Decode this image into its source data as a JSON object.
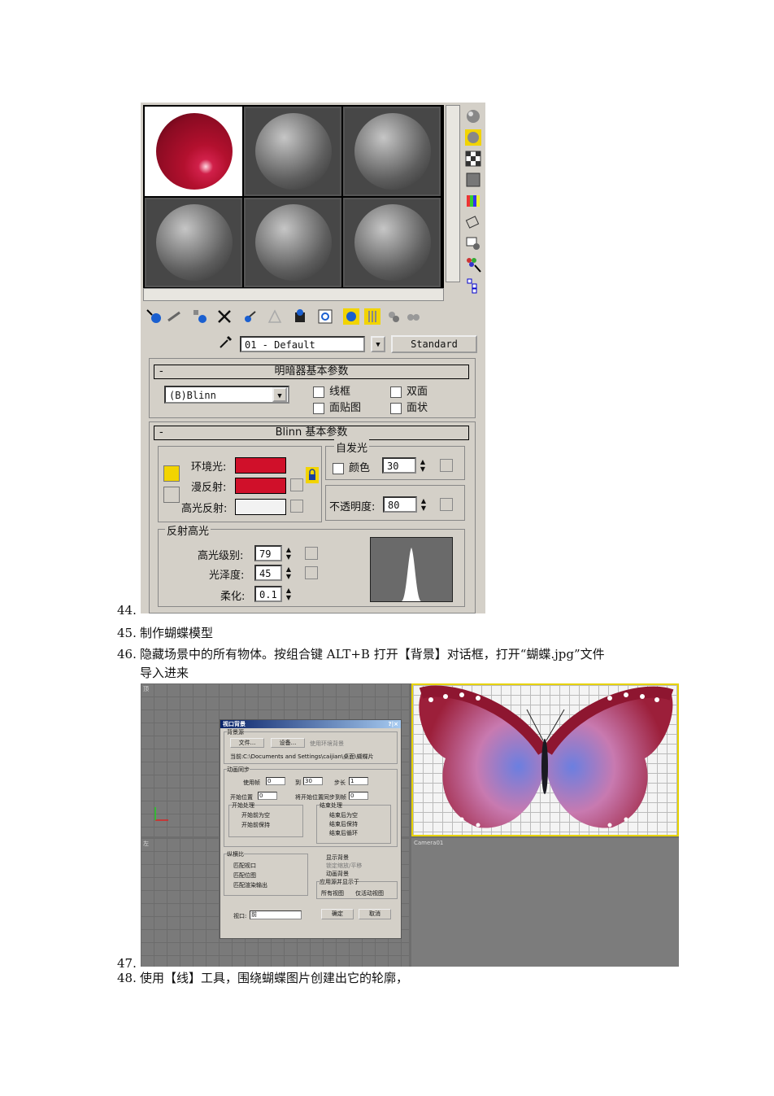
{
  "document": {
    "lines": [
      {
        "num": "44.",
        "text": ""
      },
      {
        "num": "45.",
        "text": "制作蝴蝶模型"
      },
      {
        "num": "46.",
        "text": "隐藏场景中的所有物体。按组合键 ALT+B 打开【背景】对话框，打开“蝴蝶.jpg”文件"
      },
      {
        "num": "",
        "text": "导入进来"
      },
      {
        "num": "47.",
        "text": ""
      },
      {
        "num": "48.",
        "text": "使用【线】工具，围绕蝴蝶图片创建出它的轮廓，"
      }
    ]
  },
  "material_editor": {
    "material_name": "01 - Default",
    "material_type": "Standard",
    "shader_rollout": {
      "title": "明暗器基本参数",
      "shader": "(B)Blinn",
      "checkboxes": [
        "线框",
        "双面",
        "面贴图",
        "面状"
      ]
    },
    "blinn_rollout": {
      "title": "Blinn 基本参数",
      "ambient_label": "环境光:",
      "diffuse_label": "漫反射:",
      "specular_label": "高光反射:",
      "self_illum_title": "自发光",
      "self_illum_color_label": "颜色",
      "self_illum_value": "30",
      "opacity_label": "不透明度:",
      "opacity_value": "80",
      "highlight_title": "反射高光",
      "spec_level_label": "高光级别:",
      "spec_level_value": "79",
      "gloss_label": "光泽度:",
      "gloss_value": "45",
      "soften_label": "柔化:",
      "soften_value": "0.1",
      "ambient_color": "#d0102a",
      "diffuse_color": "#d0102a",
      "specular_color": "#f2f2f2"
    }
  },
  "background_dialog": {
    "title": "视口背景",
    "help_close": "?|×",
    "source_group": "背景源",
    "files_button": "文件...",
    "devices_button": "设备...",
    "use_env_bg": "使用环境背景",
    "current_label": "当前:",
    "current_path": "C:\\Documents and Settings\\caijian\\桌面\\蝴蝶片",
    "anim_group": "动画同步",
    "use_frame": "使用帧",
    "frame_from": "0",
    "to": "到",
    "frame_to": "30",
    "step": "步长",
    "step_value": "1",
    "start_at": "开始位置",
    "start_value": "0",
    "sync_start": "将开始位置同步到帧",
    "sync_value": "0",
    "start_proc": "开始处理",
    "start_opt1": "开始前为空",
    "start_opt2": "开始前保持",
    "end_proc": "结束处理",
    "end_opt1": "结束后为空",
    "end_opt2": "结束后保持",
    "end_opt3": "结束后循环",
    "aspect_group": "纵横比",
    "aspect1": "匹配视口",
    "aspect2": "匹配位图",
    "aspect3": "匹配渲染输出",
    "display_bg": "显示背景",
    "lock_zoom": "锁定缩放/平移",
    "anim_bg": "动画背景",
    "apply_group": "应用源并显示于",
    "all_views": "所有视图",
    "active_only": "仅活动视图",
    "viewport_label": "视口:",
    "viewport_value": "前",
    "ok": "确定",
    "cancel": "取消"
  },
  "viewports": {
    "top_label": "顶",
    "left_label": "左",
    "camera_label": "Camera01"
  }
}
